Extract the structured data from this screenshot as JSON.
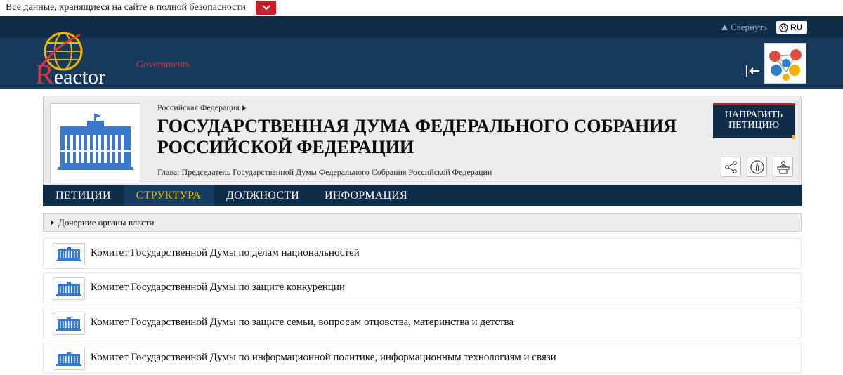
{
  "security_bar": {
    "text": "Все данные, хранящиеся на сайте в полной безопасности",
    "toggle_icon": "chevron-down-icon"
  },
  "header": {
    "collapse_label": "Свернуть",
    "language": "RU",
    "logo": {
      "brand": "eactor",
      "brand_initial": "R",
      "sub": "Governments"
    },
    "colors": {
      "primary": "#173a5c",
      "strip": "#0f2c48",
      "accent_red": "#c8202a",
      "accent_gold": "#f0b400"
    }
  },
  "entity": {
    "breadcrumb": "Российская Федерация",
    "title": "ГОСУДАРСТВЕННАЯ ДУМА ФЕДЕРАЛЬНОГО СОБРАНИЯ РОССИЙСКОЙ ФЕДЕРАЦИИ",
    "head_label": "Глава:",
    "head_value": "Председатель Государственной Думы Федерального Собрания Российской Федерации",
    "petition_button": "НАПРАВИТЬ ПЕТИЦИЮ",
    "action_icons": [
      "share-icon",
      "info-icon",
      "podium-icon"
    ]
  },
  "tabs": [
    {
      "label": "ПЕТИЦИИ",
      "active": false
    },
    {
      "label": "СТРУКТУРА",
      "active": true
    },
    {
      "label": "ДОЛЖНОСТИ",
      "active": false
    },
    {
      "label": "ИНФОРМАЦИЯ",
      "active": false
    }
  ],
  "section": {
    "title": "Дочерние органы власти"
  },
  "children": [
    "Комитет Государственной Думы по делам национальностей",
    "Комитет Государственной Думы по защите конкуренции",
    "Комитет Государственной Думы по защите семьи, вопросам отцовства, материнства и детства",
    "Комитет Государственной Думы по информационной политике, информационным технологиям и связи"
  ]
}
